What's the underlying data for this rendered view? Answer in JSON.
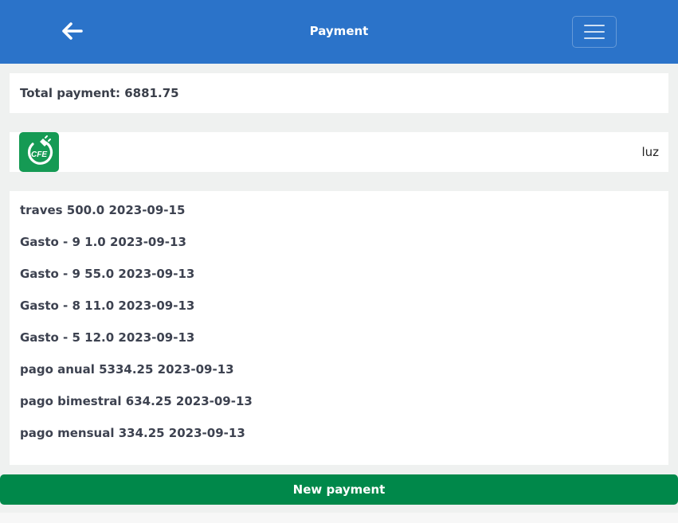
{
  "header": {
    "title": "Payment",
    "back_icon": "arrow-left-icon",
    "menu_icon": "hamburger-menu-icon",
    "color": "#2b73c9"
  },
  "summary": {
    "total_text": "Total payment: 6881.75"
  },
  "provider": {
    "logo_text": "CFE",
    "logo_color": "#159a54",
    "name": "luz"
  },
  "payments": [
    "traves 500.0 2023-09-15",
    "Gasto - 9 1.0 2023-09-13",
    "Gasto - 9 55.0 2023-09-13",
    "Gasto - 8 11.0 2023-09-13",
    "Gasto - 5 12.0 2023-09-13",
    "pago anual 5334.25 2023-09-13",
    "pago bimestral 634.25 2023-09-13",
    "pago mensual 334.25 2023-09-13"
  ],
  "actions": {
    "new_payment_label": "New payment",
    "button_color": "#00884a"
  }
}
